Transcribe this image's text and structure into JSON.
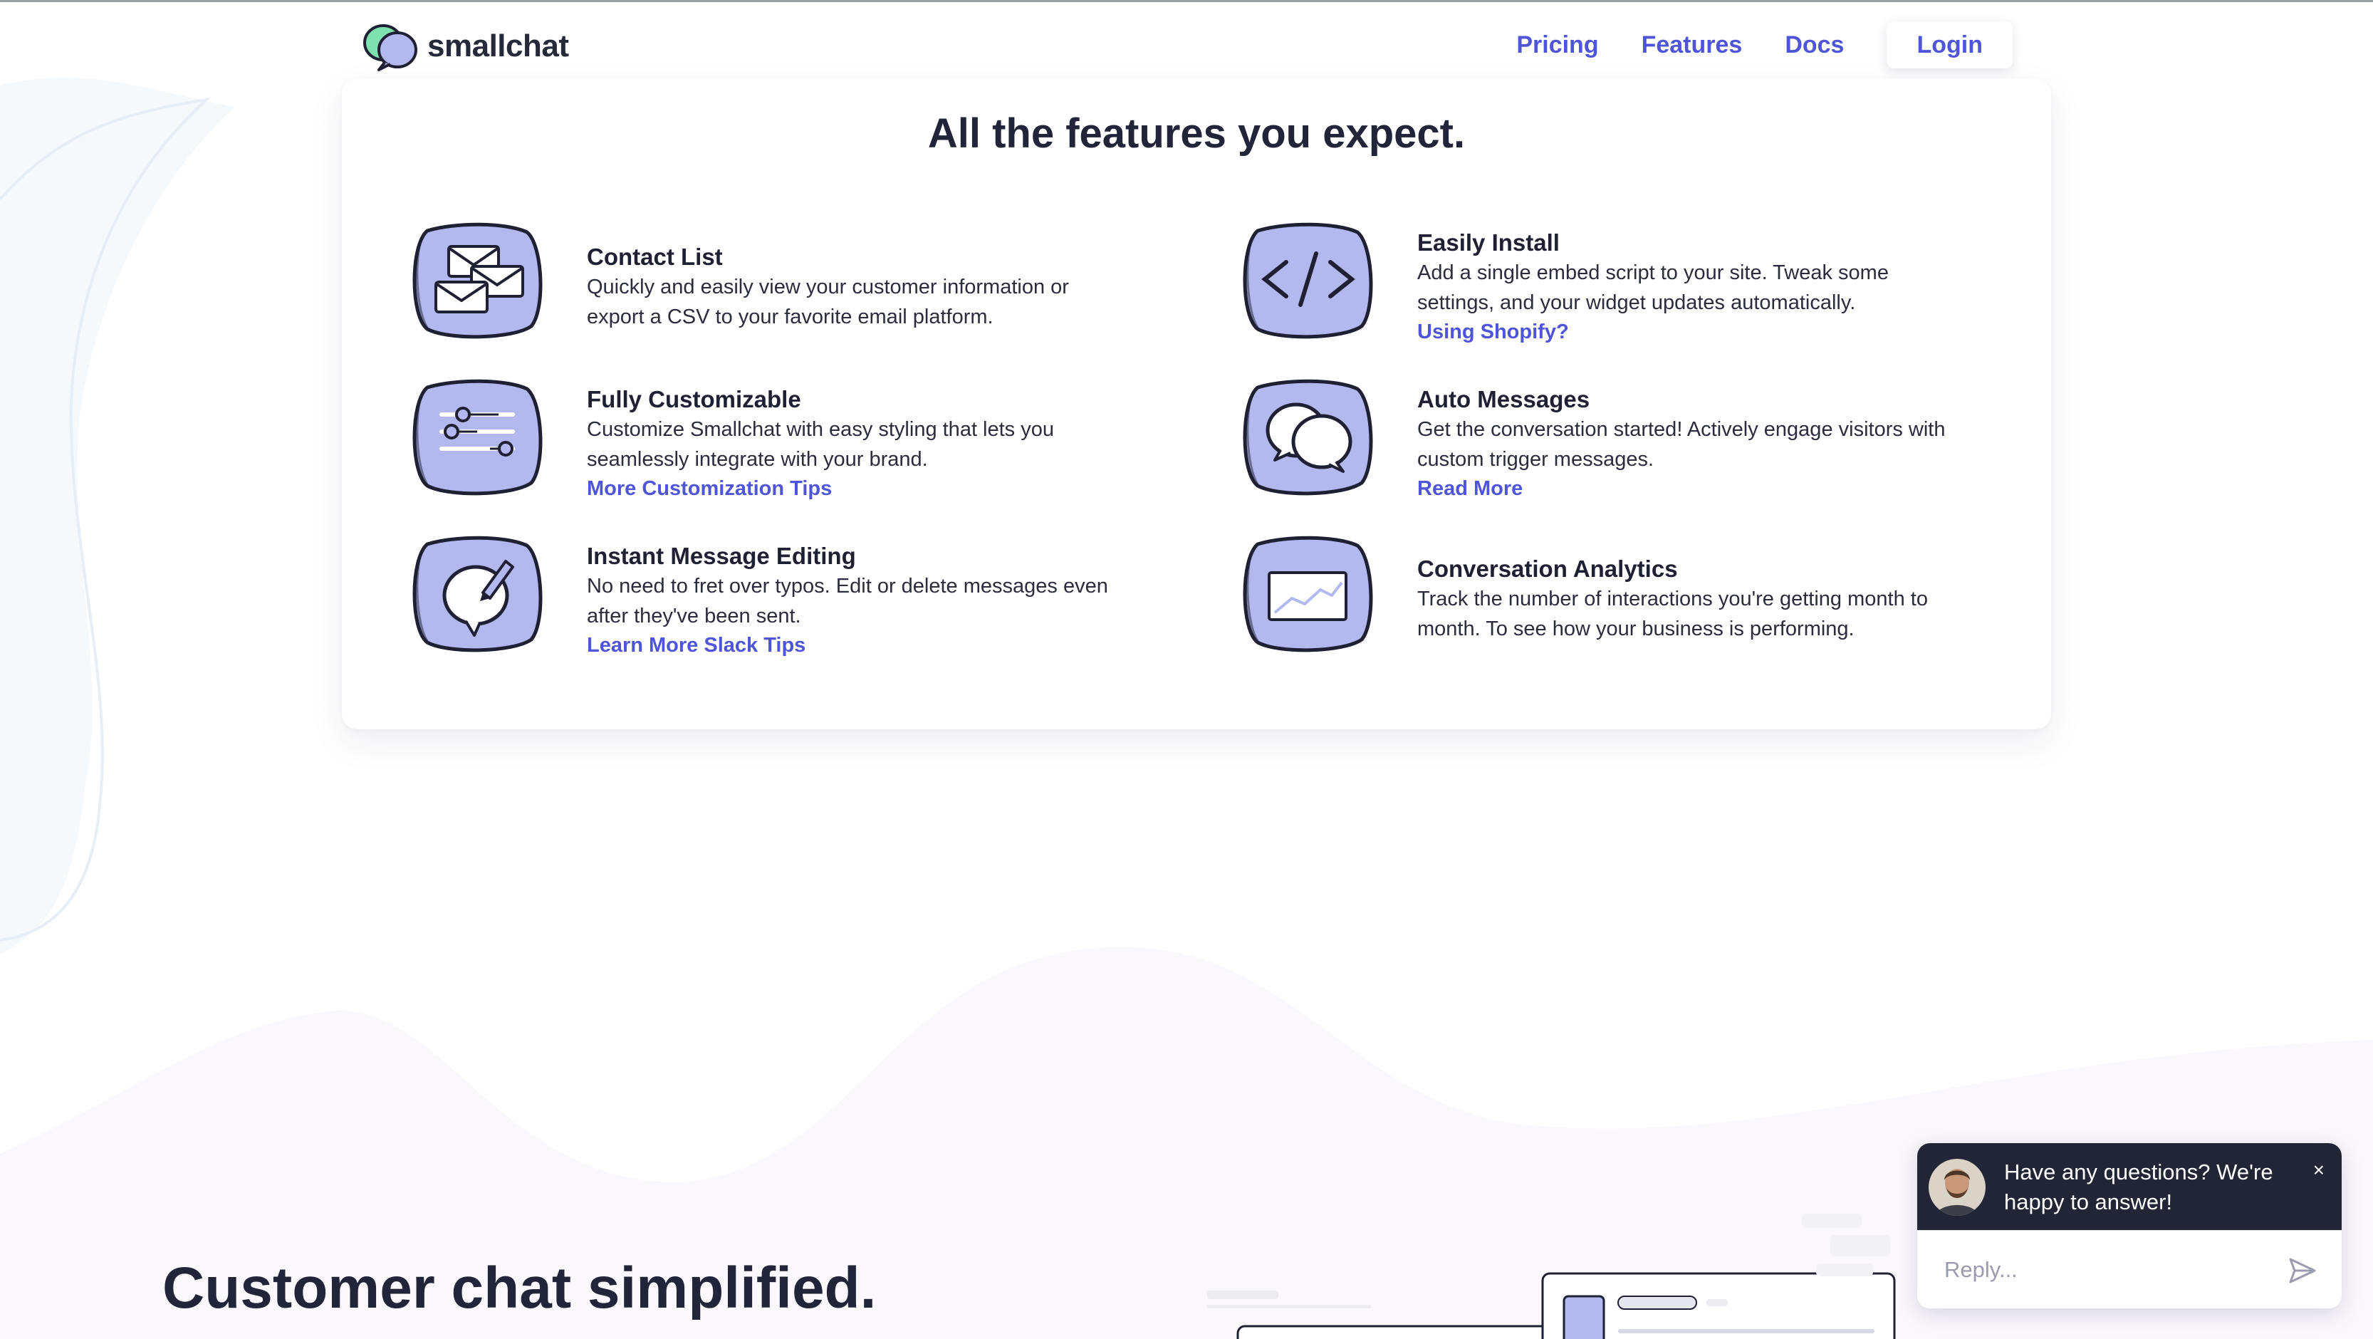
{
  "brand": {
    "name": "smallchat"
  },
  "nav": {
    "items": [
      "Pricing",
      "Features",
      "Docs"
    ],
    "login": "Login"
  },
  "features": {
    "title": "All the features you expect.",
    "items": [
      {
        "icon": "envelopes-icon",
        "title": "Contact List",
        "desc": "Quickly and easily view your customer information or export a CSV to your favorite email platform.",
        "link": ""
      },
      {
        "icon": "code-icon",
        "title": "Easily Install",
        "desc": "Add a single embed script to your site. Tweak some settings, and your widget updates automatically.",
        "link": "Using Shopify?"
      },
      {
        "icon": "sliders-icon",
        "title": "Fully Customizable",
        "desc": "Customize Smallchat with easy styling that lets you seamlessly integrate with your brand.",
        "link": "More Customization Tips"
      },
      {
        "icon": "chat-bubbles-icon",
        "title": "Auto Messages",
        "desc": "Get the conversation started! Actively engage visitors with custom trigger messages.",
        "link": "Read More"
      },
      {
        "icon": "edit-message-icon",
        "title": "Instant Message Editing",
        "desc": "No need to fret over typos. Edit or delete messages even after they've been sent.",
        "link": "Learn More Slack Tips"
      },
      {
        "icon": "analytics-chart-icon",
        "title": "Conversation Analytics",
        "desc": "Track the number of interactions you're getting month to month. To see how your business is performing.",
        "link": ""
      }
    ]
  },
  "hero": {
    "title": "Customer chat simplified."
  },
  "chat": {
    "message": "Have any questions? We're happy to answer!",
    "close": "×",
    "placeholder": "Reply..."
  },
  "colors": {
    "accent": "#4f55d8",
    "icon_fill": "#b3b8ef",
    "dark": "#222535"
  }
}
